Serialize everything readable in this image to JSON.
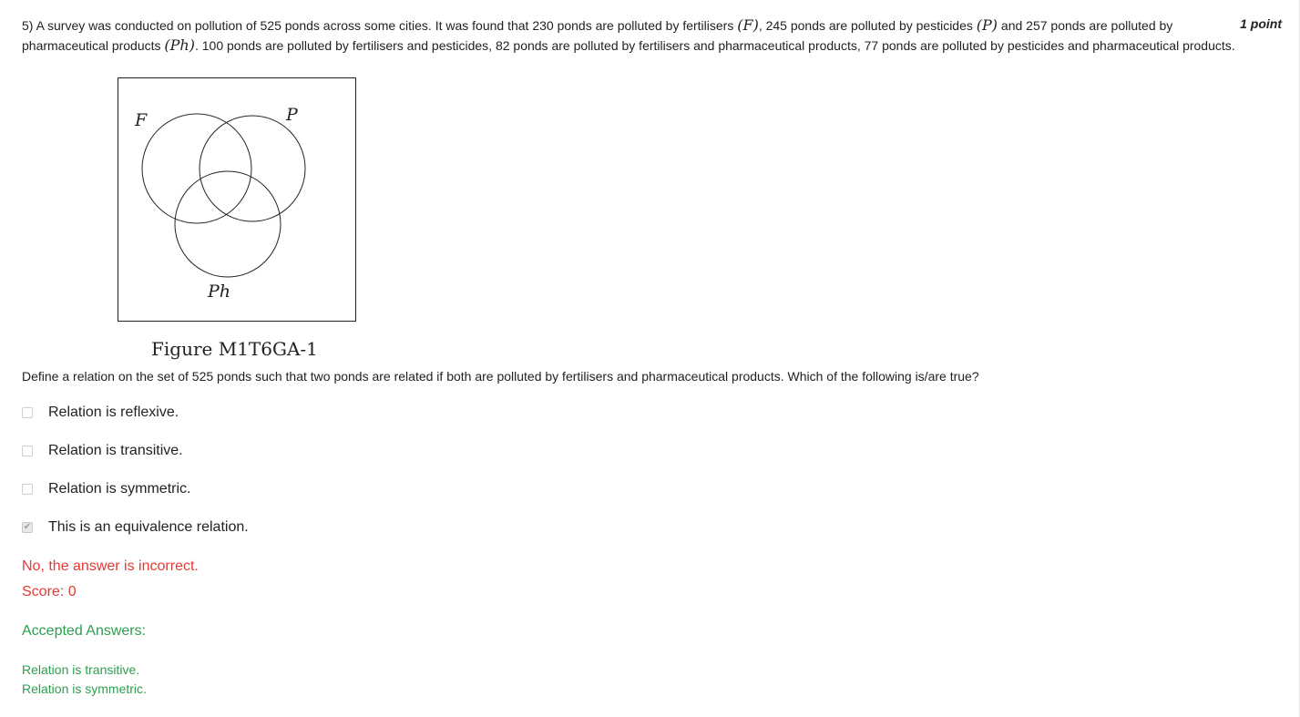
{
  "question": {
    "prefix": "5) A survey was conducted on pollution of 525 ponds across some cities. It was found that 230 ponds are polluted by fertilisers",
    "sym_f": "(F)",
    "part2": ", 245 ponds are polluted by pesticides",
    "sym_p": "(P)",
    "part3": " and 257 ponds are polluted by pharmaceutical products",
    "sym_ph": "(Ph)",
    "part4": ". 100 ponds are polluted by fertilisers and pesticides, 82 ponds are polluted by fertilisers and pharmaceutical products, 77 ponds are polluted by pesticides and pharmaceutical products.",
    "points": "1 point"
  },
  "figure": {
    "label_f": "F",
    "label_p": "P",
    "label_ph": "Ph",
    "caption": "Figure M1T6GA-1"
  },
  "sub_question": "Define a relation on the set of 525 ponds such that two ponds are related if both are polluted by fertilisers and pharmaceutical products. Which of the following is/are true?",
  "options": [
    {
      "label": "Relation is reflexive.",
      "checked": false
    },
    {
      "label": "Relation is transitive.",
      "checked": false
    },
    {
      "label": "Relation is symmetric.",
      "checked": false
    },
    {
      "label": "This is an equivalence relation.",
      "checked": true
    }
  ],
  "feedback": {
    "message": "No, the answer is incorrect.",
    "score": "Score: 0"
  },
  "accepted": {
    "title": "Accepted Answers:",
    "answers": [
      "Relation is transitive.",
      "Relation is symmetric."
    ]
  },
  "colors": {
    "incorrect": "#e53935",
    "accepted": "#2e9e4f"
  }
}
